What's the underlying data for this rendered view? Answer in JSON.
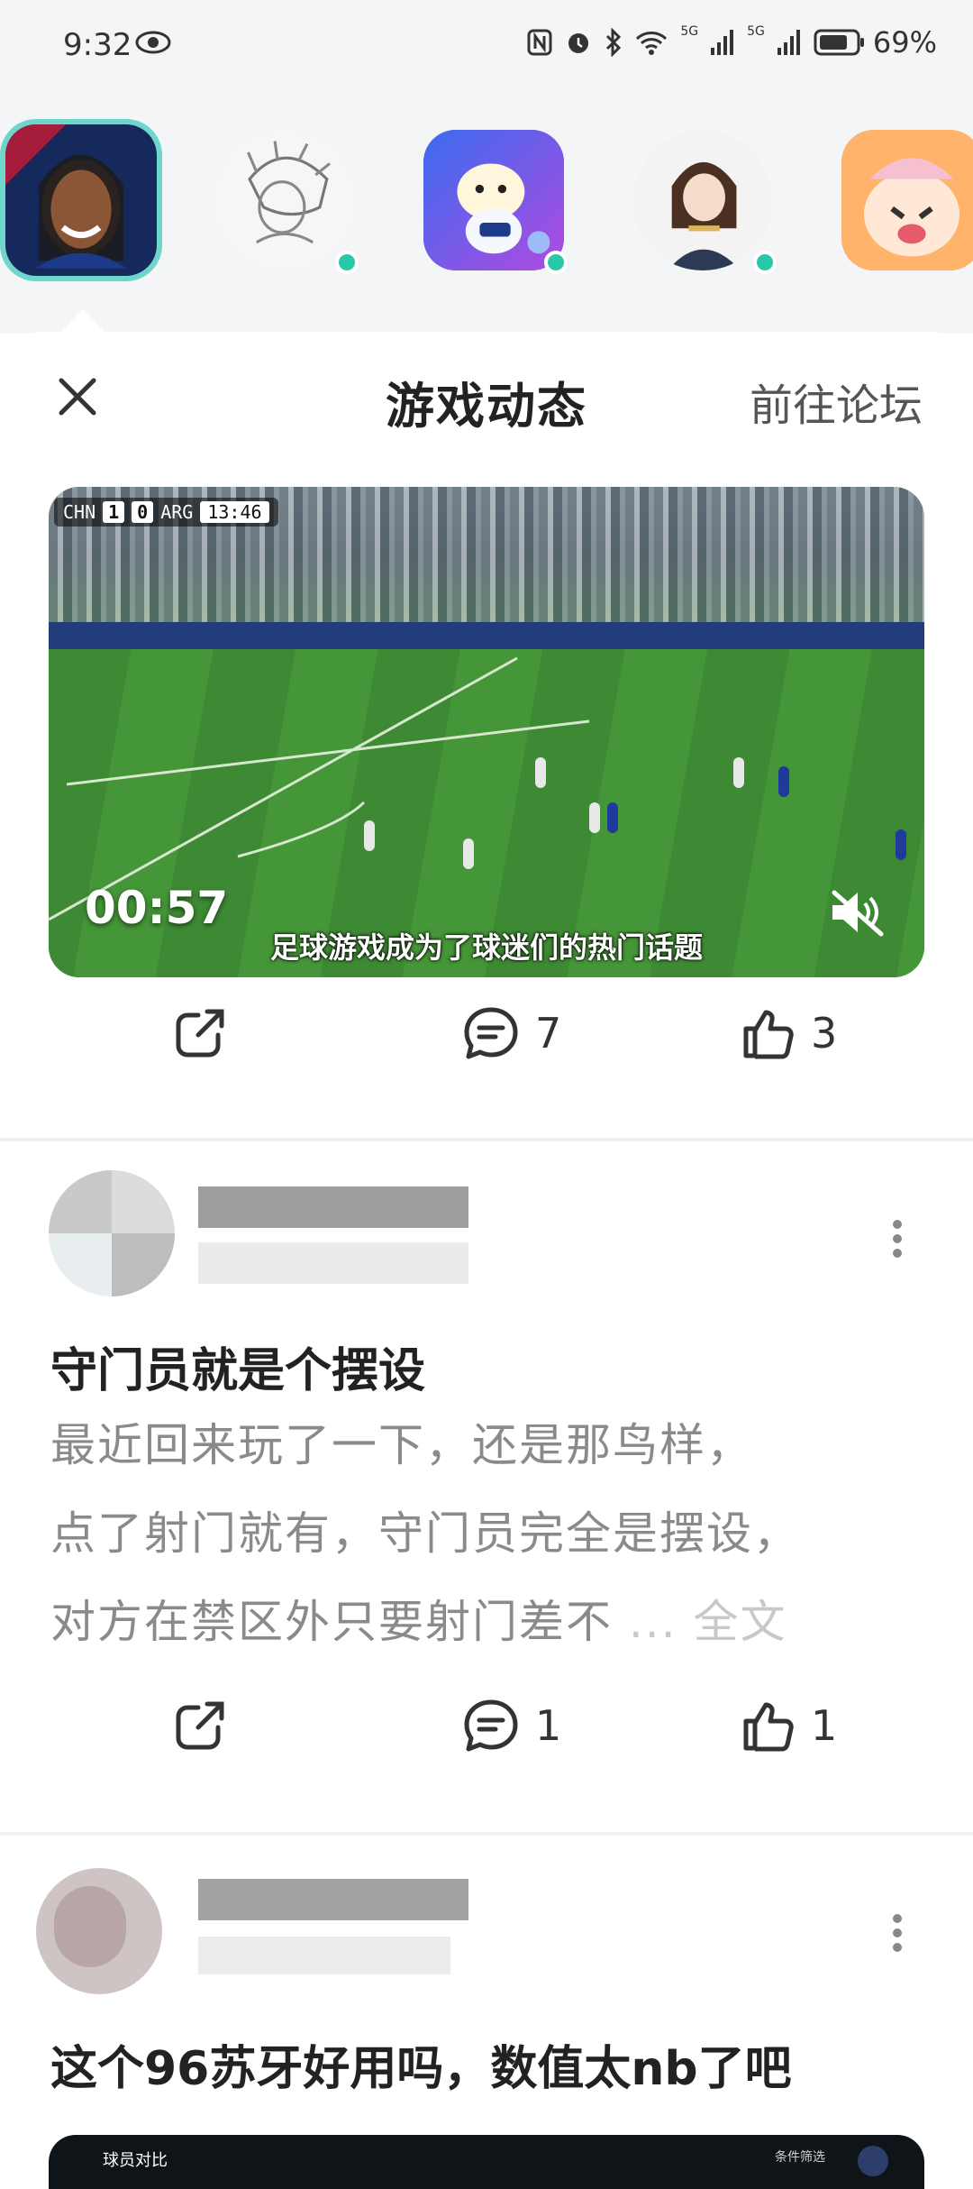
{
  "status_bar": {
    "time": "9:32",
    "network_1": "5G",
    "network_2": "5G",
    "battery": "69%"
  },
  "apps": [
    {
      "name": "ronaldinho-avatar",
      "selected": true,
      "online": false
    },
    {
      "name": "sketch-character-avatar",
      "selected": false,
      "online": true
    },
    {
      "name": "mascot-game-avatar",
      "selected": false,
      "online": true
    },
    {
      "name": "anime-girl-avatar",
      "selected": false,
      "online": true
    },
    {
      "name": "cartoon-tiger-avatar",
      "selected": false,
      "online": false
    }
  ],
  "sheet": {
    "title": "游戏动态",
    "forum_link": "前往论坛"
  },
  "video_post": {
    "duration": "00:57",
    "caption": "足球游戏成为了球迷们的热门话题",
    "scoreboard": {
      "home": "CHN",
      "home_score": "1",
      "away_score": "0",
      "away": "ARG",
      "clock": "13:46"
    },
    "comments": "7",
    "likes": "3"
  },
  "post_1": {
    "title": "守门员就是个摆设",
    "body_lines": [
      "最近回来玩了一下，还是那鸟样，",
      "点了射门就有，守门员完全是摆设，",
      "对方在禁区外只要射门差不"
    ],
    "ellipsis": "...",
    "more_label": "全文",
    "comments": "1",
    "likes": "1"
  },
  "post_2": {
    "title": "这个96苏牙好用吗，数值太nb了吧",
    "thumb_label": "球员对比",
    "thumb_sub": "条件筛选"
  },
  "colors": {
    "accent_teal": "#6fd6cc",
    "online_dot": "#2bc7a9",
    "muted_text": "#8a8a8a"
  }
}
